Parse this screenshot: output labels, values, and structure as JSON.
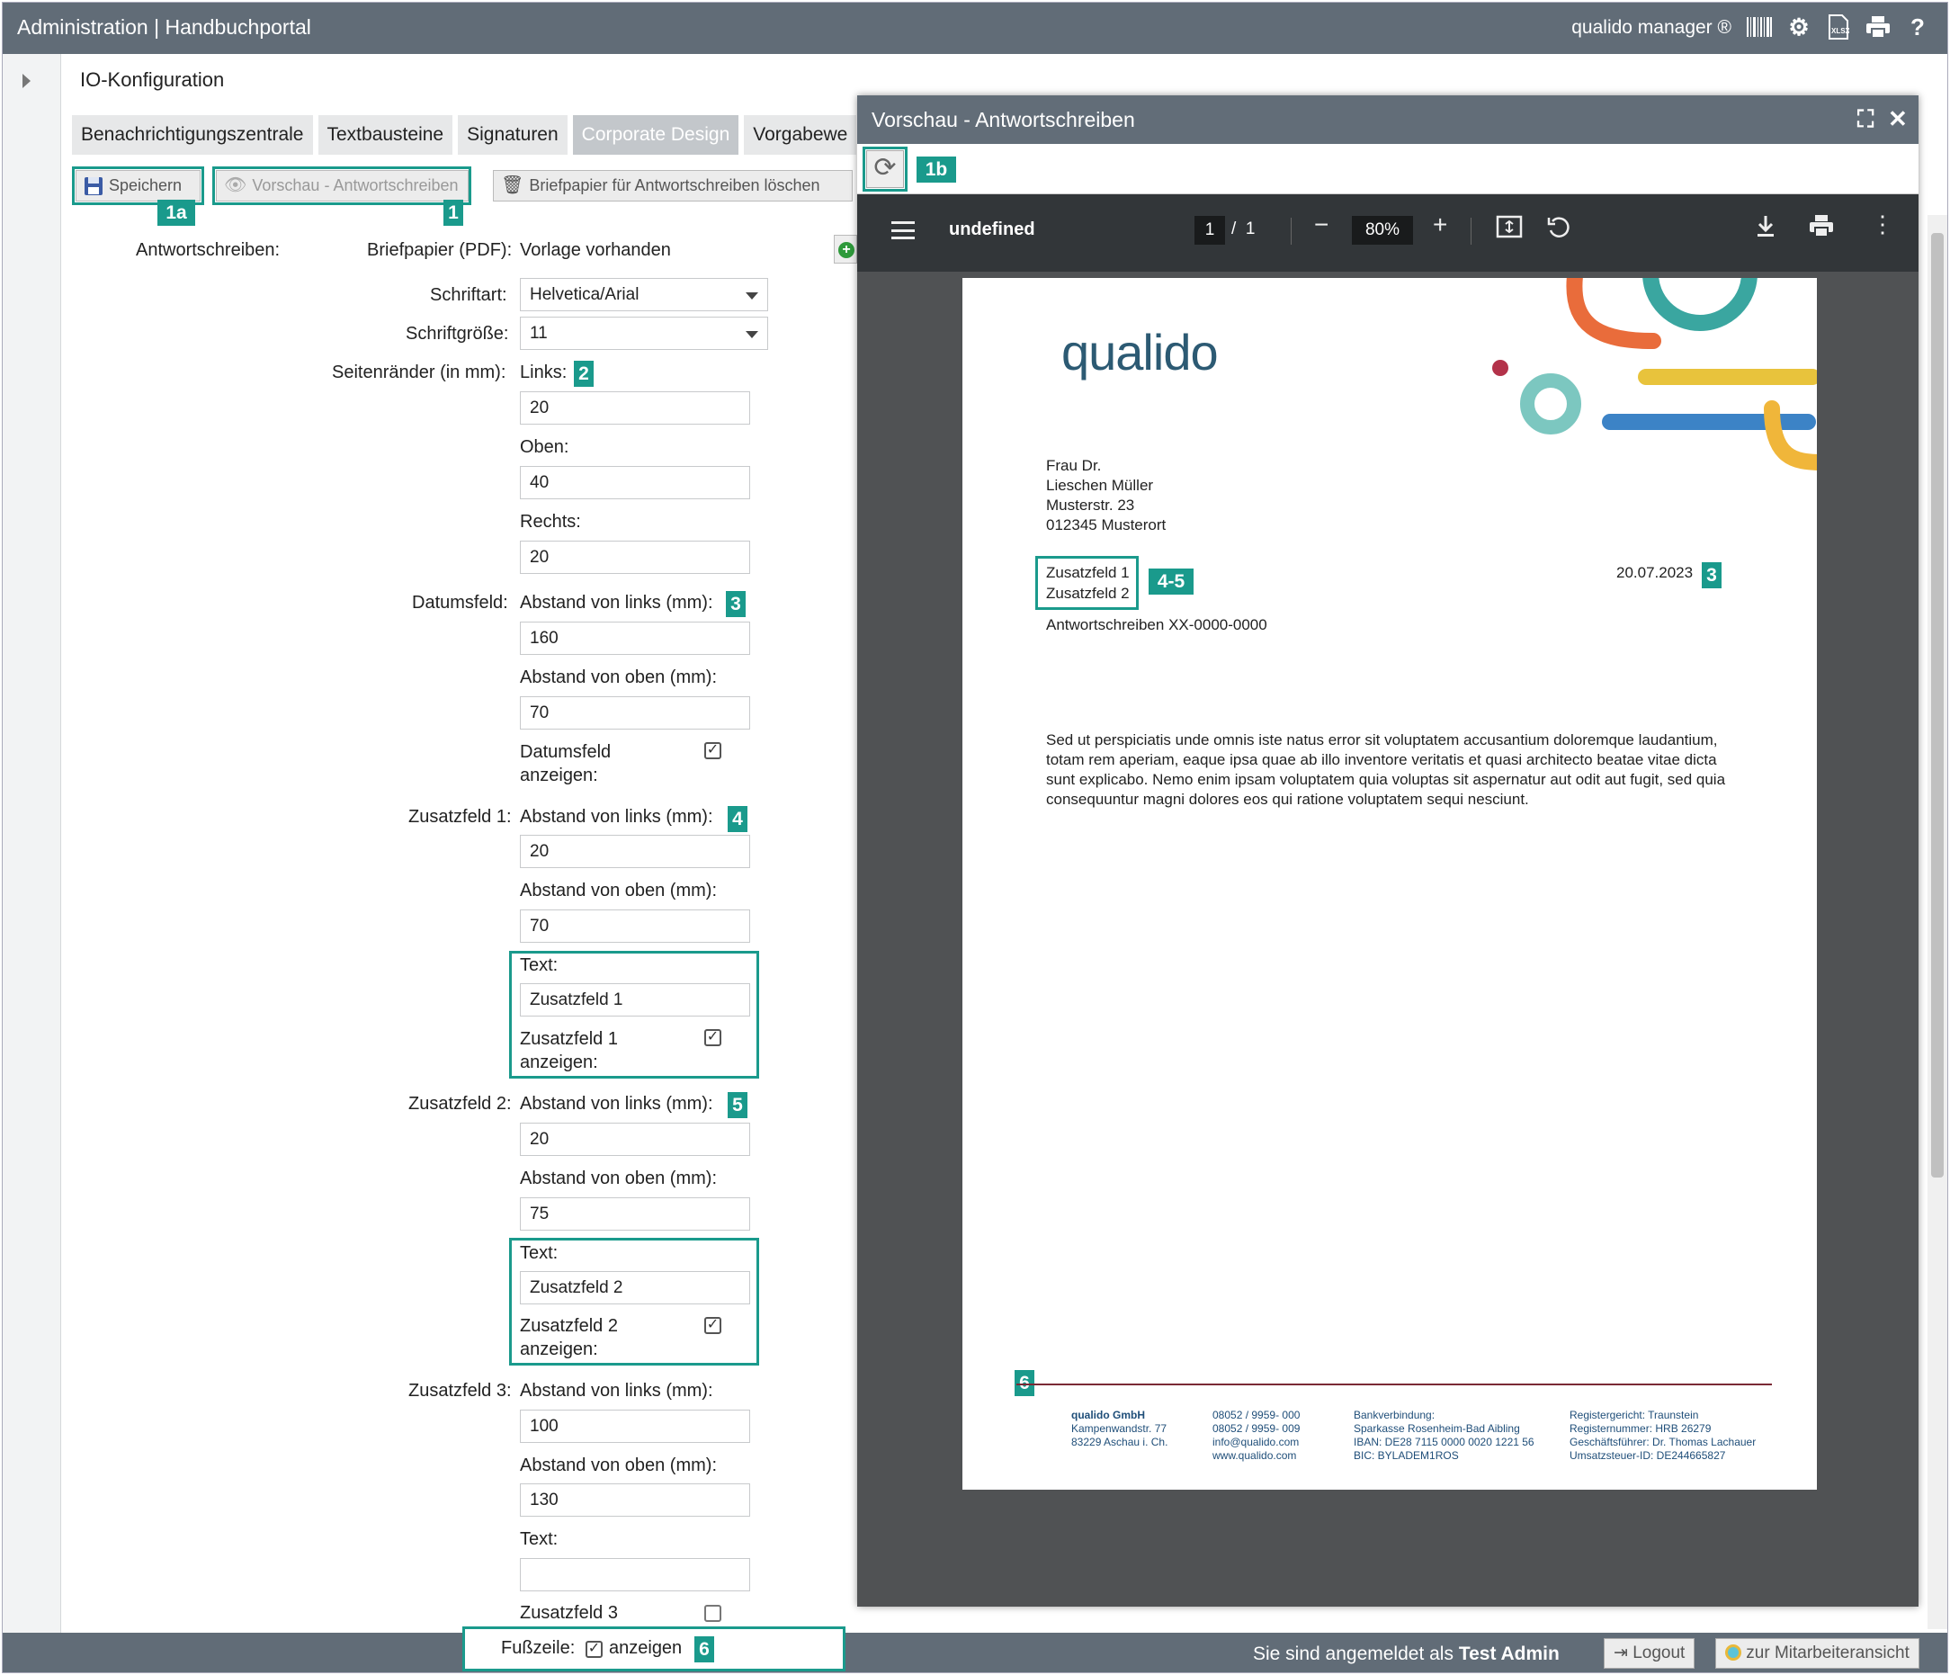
{
  "header": {
    "title": "Administration | Handbuchportal",
    "brand": "qualido manager ®"
  },
  "page": {
    "title": "IO-Konfiguration"
  },
  "tabs": [
    {
      "label": "Benachrichtigungszentrale"
    },
    {
      "label": "Textbausteine"
    },
    {
      "label": "Signaturen"
    },
    {
      "label": "Corporate Design"
    },
    {
      "label": "Vorgabewe"
    }
  ],
  "toolbar": {
    "save": "Speichern",
    "preview": "Vorschau - Antwortschreiben",
    "delete": "Briefpapier für Antwortschreiben löschen"
  },
  "badges": {
    "save": "1a",
    "preview": "1",
    "reload": "1b",
    "margins": "2",
    "date": "3",
    "extra1": "4",
    "extra2": "5",
    "footer": "6",
    "pdf_extra": "4-5",
    "pdf_date": "3",
    "pdf_footer": "6"
  },
  "form": {
    "reply_label": "Antwortschreiben:",
    "letterhead_label": "Briefpapier (PDF):",
    "letterhead_value": "Vorlage vorhanden",
    "font_label": "Schriftart:",
    "font_value": "Helvetica/Arial",
    "size_label": "Schriftgröße:",
    "size_value": "11",
    "margins_label": "Seitenränder (in mm):",
    "left_label": "Links:",
    "left_value": "20",
    "top_label": "Oben:",
    "top_value": "40",
    "right_label": "Rechts:",
    "right_value": "20",
    "date_label": "Datumsfeld:",
    "from_left": "Abstand von links (mm):",
    "from_top": "Abstand von oben (mm):",
    "date_left": "160",
    "date_top": "70",
    "date_show_1": "Datumsfeld",
    "date_show_2": "anzeigen:",
    "z1_label": "Zusatzfeld 1:",
    "z1_left": "20",
    "z1_top": "70",
    "text_label": "Text:",
    "z1_text": "Zusatzfeld 1",
    "z1_show_1": "Zusatzfeld 1",
    "z1_show_2": "anzeigen:",
    "z2_label": "Zusatzfeld 2:",
    "z2_left": "20",
    "z2_top": "75",
    "z2_text": "Zusatzfeld 2",
    "z2_show_1": "Zusatzfeld 2",
    "z2_show_2": "anzeigen:",
    "z3_label": "Zusatzfeld 3:",
    "z3_left": "100",
    "z3_top": "130",
    "z3_text": "",
    "z3_show_1": "Zusatzfeld 3",
    "footer_label": "Fußzeile:",
    "footer_show": "anzeigen"
  },
  "modal": {
    "title": "Vorschau - Antwortschreiben",
    "file_name": "undefined",
    "page_current": "1",
    "page_sep": "/",
    "page_total": "1",
    "zoom": "80%"
  },
  "letter": {
    "logo": "qualido",
    "address": [
      "Frau Dr.",
      "Lieschen Müller",
      "Musterstr. 23",
      "012345 Musterort"
    ],
    "extra1": "Zusatzfeld 1",
    "extra2": "Zusatzfeld 2",
    "date": "20.07.2023",
    "subject": "Antwortschreiben XX-0000-0000",
    "body": "Sed ut perspiciatis unde omnis iste natus error sit voluptatem accusantium doloremque laudantium, totam rem aperiam, eaque ipsa quae ab illo inventore veritatis et quasi architecto beatae vitae dicta sunt explicabo. Nemo enim ipsam voluptatem quia voluptas sit aspernatur aut odit aut fugit, sed quia consequuntur magni dolores eos qui ratione voluptatem sequi nesciunt.",
    "footer": [
      [
        "qualido GmbH",
        "Kampenwandstr. 77",
        "83229 Aschau i. Ch."
      ],
      [
        "08052 / 9959- 000",
        "08052 / 9959- 009",
        "info@qualido.com",
        "www.qualido.com"
      ],
      [
        "Bankverbindung:",
        "Sparkasse Rosenheim-Bad Aibling",
        "IBAN: DE28 7115 0000 0020 1221 56",
        "BIC: BYLADEM1ROS"
      ],
      [
        "Registergericht: Traunstein",
        "Registernummer: HRB 26279",
        "Geschäftsführer: Dr. Thomas Lachauer",
        "Umsatzsteuer-ID: DE244665827"
      ]
    ]
  },
  "bottom": {
    "login_prefix": "Sie sind angemeldet als",
    "user": "Test Admin",
    "logout": "Logout",
    "employee_view": "zur Mitarbeiteransicht"
  },
  "colors": {
    "accent": "#1a9a8c",
    "bar": "#616c77",
    "pdf_toolbar": "#323639"
  },
  "icons": [
    "barcode-icon",
    "gears-icon",
    "xlsx-icon",
    "print-icon",
    "help-icon",
    "save-icon",
    "eye-icon",
    "trash-icon",
    "reload-icon",
    "fullscreen-icon",
    "close-icon",
    "menu-icon",
    "download-icon",
    "more-icon"
  ]
}
